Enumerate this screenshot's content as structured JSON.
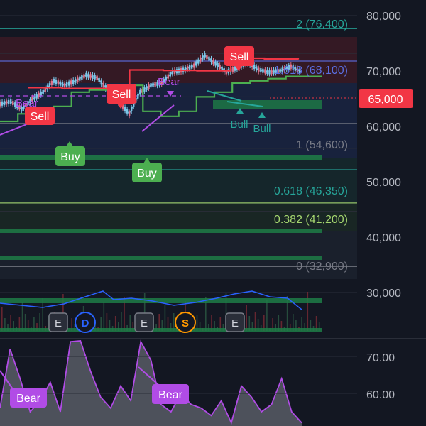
{
  "chart_data": [
    {
      "type": "line",
      "role": "price-candles-with-fibonacci-levels",
      "y_axis": {
        "scale": "log",
        "range": [
          27000,
          86000
        ],
        "ticks": [
          "80,000",
          "70,000",
          "60,000",
          "50,000",
          "40,000",
          "30,000"
        ],
        "tick_values": [
          80000,
          70000,
          60000,
          50000,
          40000,
          30000
        ]
      },
      "current_price": {
        "label": "65,000",
        "value": 65000,
        "color": "#f23645"
      },
      "fib_levels": [
        {
          "label": "2 (76,400)",
          "value": 76400,
          "color": "#26a69a"
        },
        {
          "label": "1.618 (68,100)",
          "value": 68100,
          "color": "#5b6ee1"
        },
        {
          "label": "1 (54,600)",
          "value": 54600,
          "color": "#787b86"
        },
        {
          "label": "0.618 (46,350)",
          "value": 46350,
          "color": "#26a69a"
        },
        {
          "label": "0.382 (41,200)",
          "value": 41200,
          "color": "#a5d66f"
        },
        {
          "label": "0 (32,900)",
          "value": 32900,
          "color": "#787b86"
        }
      ],
      "price_series": [
        58500,
        59000,
        57500,
        59500,
        61000,
        63500,
        62500,
        63500,
        64800,
        64200,
        61500,
        59000,
        56500,
        61000,
        62500,
        63000,
        65500,
        66000,
        67000,
        69500,
        67500,
        65500,
        66500,
        67800,
        66000,
        65500,
        65800,
        66800,
        65500
      ],
      "trailing_stop_green": [
        55000,
        56500,
        57000,
        58000,
        61000,
        61500,
        62000,
        62500,
        57000,
        56000,
        57000,
        60000,
        61000,
        63000,
        63500,
        64000,
        64500,
        64500,
        64500
      ],
      "trailing_stop_red": [
        62000,
        61800,
        61800,
        66000,
        65900,
        65800,
        68800,
        68600,
        68500
      ],
      "signals": [
        {
          "label": "Sell",
          "type": "sell",
          "color": "#f23645",
          "value": 63500
        },
        {
          "label": "Buy",
          "type": "buy",
          "color": "#4caf50",
          "value": 58000
        },
        {
          "label": "Sell",
          "type": "sell",
          "color": "#f23645",
          "value": 66000
        },
        {
          "label": "Buy",
          "type": "buy",
          "color": "#4caf50",
          "value": 55000
        },
        {
          "label": "Sell",
          "type": "sell",
          "color": "#f23645",
          "value": 69500
        }
      ],
      "divergence_labels": [
        {
          "label": "Bear",
          "color": "#b14ce6"
        },
        {
          "label": "Bear",
          "color": "#b14ce6"
        },
        {
          "label": "Bull",
          "color": "#26a69a"
        },
        {
          "label": "Bull",
          "color": "#26a69a"
        }
      ],
      "event_markers": [
        {
          "label": "E",
          "kind": "earnings",
          "color": "#b2b5be"
        },
        {
          "label": "D",
          "kind": "dividend",
          "color": "#2962ff"
        },
        {
          "label": "E",
          "kind": "earnings",
          "color": "#b2b5be"
        },
        {
          "label": "S",
          "kind": "split",
          "color": "#ff9800"
        },
        {
          "label": "E",
          "kind": "earnings",
          "color": "#b2b5be"
        }
      ]
    },
    {
      "type": "area",
      "role": "oscillator-pane",
      "y_axis": {
        "ticks": [
          "70.00",
          "60.00"
        ],
        "tick_values": [
          70,
          60
        ]
      },
      "line_color": "#b14ce6",
      "fill_color": "#9598a1",
      "values": [
        56,
        72,
        64,
        55,
        58,
        63,
        55,
        74,
        81,
        66,
        59,
        56,
        62,
        58,
        74,
        69,
        57,
        55,
        60,
        57,
        56,
        54,
        58,
        52,
        62,
        59,
        55,
        57,
        64,
        55,
        52
      ],
      "divergence_labels": [
        {
          "label": "Bear",
          "color": "#b14ce6"
        },
        {
          "label": "Bear",
          "color": "#b14ce6"
        }
      ]
    }
  ]
}
